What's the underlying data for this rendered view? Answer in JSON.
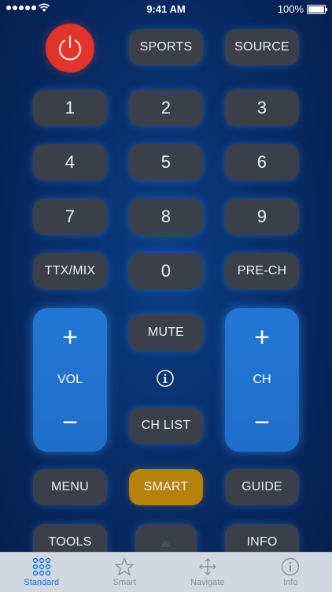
{
  "status_bar": {
    "time": "9:41 AM",
    "battery": "100%"
  },
  "buttons": {
    "sports": "SPORTS",
    "source": "SOURCE",
    "num_1": "1",
    "num_2": "2",
    "num_3": "3",
    "num_4": "4",
    "num_5": "5",
    "num_6": "6",
    "num_7": "7",
    "num_8": "8",
    "num_9": "9",
    "ttx_mix": "TTX/MIX",
    "num_0": "0",
    "pre_ch": "PRE-CH",
    "mute": "MUTE",
    "ch_list": "CH LIST",
    "menu": "MENU",
    "smart": "SMART",
    "guide": "GUIDE",
    "tools": "TOOLS",
    "info": "INFO"
  },
  "volume": {
    "plus": "+",
    "label": "VOL",
    "minus": "−"
  },
  "channel": {
    "plus": "+",
    "label": "CH",
    "minus": "−"
  },
  "tabs": [
    {
      "label": "Standard",
      "icon": "grid-icon"
    },
    {
      "label": "Smart",
      "icon": "star-icon"
    },
    {
      "label": "Navigate",
      "icon": "move-arrows-icon"
    },
    {
      "label": "Info",
      "icon": "info-circle-icon"
    }
  ],
  "colors": {
    "background": "#082d68",
    "button": "#3a3f4a",
    "power": "#e1342c",
    "rocker": "#2377d4",
    "smart": "#b7820c",
    "tab_active": "#1473e6",
    "tab_inactive": "#8a9099"
  }
}
